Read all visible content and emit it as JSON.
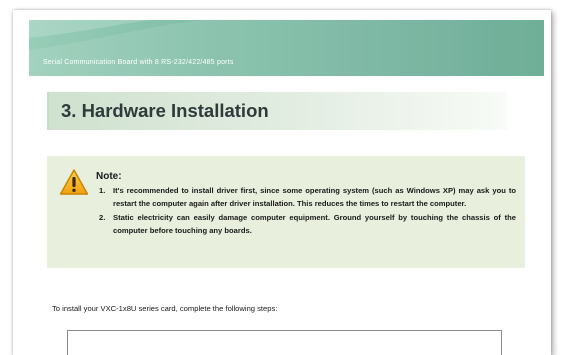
{
  "banner": {
    "text": "Serial Communication Board with 8 RS-232/422/485 ports",
    "colors": [
      "#98cdb8",
      "#5fa58c"
    ]
  },
  "heading": {
    "text": "3. Hardware Installation"
  },
  "note": {
    "icon": "warning-icon",
    "title": "Note:",
    "items": [
      {
        "num": "1.",
        "text": "It's recommended to install driver first, since some operating system (such as Windows XP) may ask you to restart the computer again after driver installation. This reduces the times to restart the computer."
      },
      {
        "num": "2.",
        "text": "Static electricity can easily damage computer equipment. Ground yourself by touching the chassis of the computer before touching any boards."
      }
    ],
    "background": "#e8efdd"
  },
  "intro": {
    "text": "To install your VXC-1x8U series card, complete the following steps:"
  }
}
